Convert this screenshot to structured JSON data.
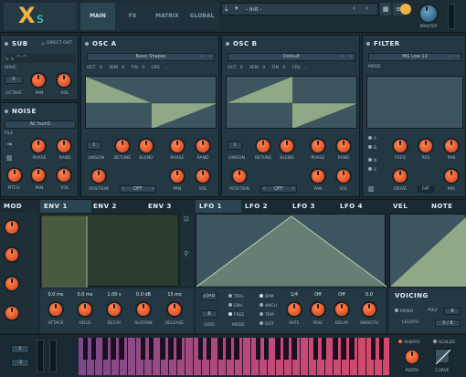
{
  "app": {
    "logo_x": "X",
    "logo_s": "s"
  },
  "top_tabs": [
    {
      "label": "MAIN"
    },
    {
      "label": "FX"
    },
    {
      "label": "MATRIX"
    },
    {
      "label": "GLOBAL"
    }
  ],
  "preset": {
    "name": "- Init -"
  },
  "master": {
    "label": "MASTER"
  },
  "sub": {
    "title": "SUB",
    "direct_out": "DIRECT OUT",
    "wave": "WAVE",
    "octave_value": "0",
    "octave": "OCTAVE",
    "pan": "PAN",
    "vol": "VOL"
  },
  "noise": {
    "title": "NOISE",
    "preset": "AC hum1",
    "file": "FILE",
    "phase": "PHASE",
    "rand": "RAND",
    "pitch": "PITCH",
    "pan": "PAN",
    "vol": "VOL"
  },
  "osc_a": {
    "title": "OSC A",
    "preset": "Basic Shapes",
    "top_labels": [
      "OCT",
      "SEM",
      "FIN",
      "CRS"
    ],
    "top_values": [
      "0",
      "0",
      "0",
      "..."
    ],
    "unison_value": "1",
    "row1": [
      "UNISON",
      "DETUNE",
      "BLEND",
      "PHASE",
      "RAND"
    ],
    "row2": [
      "POSITION",
      "PAN",
      "VOL"
    ],
    "mode": "OFF"
  },
  "osc_b": {
    "title": "OSC B",
    "preset": "Default",
    "top_labels": [
      "OCT",
      "SEM",
      "FIN",
      "CRS"
    ],
    "top_values": [
      "0",
      "0",
      "0",
      "..."
    ],
    "unison_value": "1",
    "row1": [
      "UNISON",
      "DETUNE",
      "BLEND",
      "PHASE",
      "RAND"
    ],
    "row2": [
      "POSITION",
      "PAN",
      "VOL"
    ],
    "mode": "OFF"
  },
  "filter": {
    "title": "FILTER",
    "type": "MG Low 12",
    "mode": "MODE",
    "routes": [
      "A",
      "B",
      "N",
      "S"
    ],
    "row1": [
      "FREQ",
      "RES",
      "PAN"
    ],
    "row2": [
      "DRIVE",
      "FAT",
      "MIX"
    ]
  },
  "mod": {
    "tabs": [
      "MOD",
      "ENV 1",
      "ENV 2",
      "ENV 3",
      "LFO 1",
      "LFO 2",
      "LFO 3",
      "LFO 4",
      "VEL",
      "NOTE"
    ]
  },
  "env": {
    "values": [
      "0.0 ms",
      "0.0 ms",
      "1.00 s",
      "0.0 dB",
      "15 ms"
    ],
    "labels": [
      "ATTACK",
      "HOLD",
      "DECAY",
      "SUSTAIN",
      "RELEASE"
    ]
  },
  "lfo": {
    "load": "LOAD",
    "grid_value": "8",
    "grid": "GRID",
    "mode": "MODE",
    "mode_opts": [
      "TRIG",
      "ENV",
      "FREE"
    ],
    "rate_opts": [
      "BPM",
      "ANCH",
      "TRIP",
      "DOT"
    ],
    "values": [
      "1/4",
      "Off",
      "Off",
      "0.0"
    ],
    "labels": [
      "RATE",
      "RISE",
      "DELAY",
      "SMOOTH"
    ]
  },
  "voicing": {
    "title": "VOICING",
    "mono": "MONO",
    "poly": "POLY",
    "poly_value": "8",
    "legato": "LEGATO",
    "legato_value": "0 / 8"
  },
  "bottom": {
    "pitch_up": "2",
    "pitch_down": "-2",
    "always": "ALWAYS",
    "scaled": "SCALED",
    "porta": "PORTA",
    "curve": "CURVE"
  },
  "colors": {
    "accent": "#ff6a33",
    "panel": "#243844",
    "teal": "#4ec6d8",
    "wave_fill": "#8fa885"
  }
}
